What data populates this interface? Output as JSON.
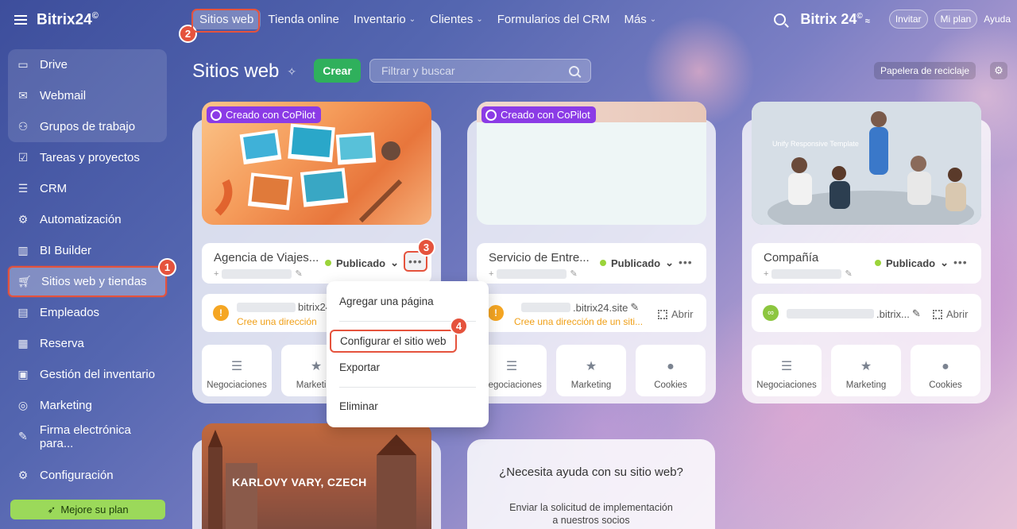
{
  "header": {
    "brand": "Bitrix24",
    "brand_mark": "©",
    "nav": [
      {
        "label": "Sitios web",
        "active": true
      },
      {
        "label": "Tienda online"
      },
      {
        "label": "Inventario",
        "chevron": "⌄"
      },
      {
        "label": "Clientes",
        "chevron": "⌄"
      },
      {
        "label": "Formularios del CRM"
      },
      {
        "label": "Más",
        "chevron": "⌄"
      }
    ],
    "logo_right": "Bitrix 24",
    "invite": "Invitar",
    "my_plan": "Mi plan",
    "help": "Ayuda"
  },
  "sidebar": {
    "items": [
      {
        "label": "Drive",
        "icon": "drive-icon"
      },
      {
        "label": "Webmail",
        "icon": "mail-icon"
      },
      {
        "label": "Grupos de trabajo",
        "icon": "groups-icon"
      },
      {
        "label": "Tareas y proyectos",
        "icon": "tasks-icon"
      },
      {
        "label": "CRM",
        "icon": "crm-icon"
      },
      {
        "label": "Automatización",
        "icon": "automation-icon"
      },
      {
        "label": "BI Builder",
        "icon": "bi-icon"
      },
      {
        "label": "Sitios web y tiendas",
        "icon": "cart-icon",
        "highlight": true
      },
      {
        "label": "Empleados",
        "icon": "employees-icon"
      },
      {
        "label": "Reserva",
        "icon": "calendar-icon"
      },
      {
        "label": "Gestión del inventario",
        "icon": "inventory-icon"
      },
      {
        "label": "Marketing",
        "icon": "marketing-icon"
      },
      {
        "label": "Firma electrónica para...",
        "icon": "signature-icon"
      }
    ],
    "settings": "Configuración",
    "upgrade": "Mejore su plan"
  },
  "page": {
    "title": "Sitios web",
    "create": "Crear",
    "filter_placeholder": "Filtrar y buscar",
    "trash": "Papelera de reciclaje"
  },
  "cards": [
    {
      "copilot": "Creado con CoPilot",
      "name": "Agencia de Viajes...",
      "status": "Publicado",
      "url_suffix": "bitrix24",
      "url_warning": "Cree una dirección",
      "tiles": [
        "Negociaciones",
        "Marketing"
      ]
    },
    {
      "copilot": "Creado con CoPilot",
      "name": "Servicio de Entre...",
      "status": "Publicado",
      "url_suffix": ".bitrix24.site",
      "url_warning": "Cree una dirección de un siti...",
      "open": "Abrir",
      "tiles": [
        "Negociaciones",
        "Marketing",
        "Cookies"
      ]
    },
    {
      "name": "Compañía",
      "status": "Publicado",
      "url_suffix": ".bitrix...",
      "open": "Abrir",
      "tiles": [
        "Negociaciones",
        "Marketing",
        "Cookies"
      ],
      "thumb_text": "Unify Responsive Template"
    }
  ],
  "menu": {
    "add_page": "Agregar una página",
    "configure": "Configurar el sitio web",
    "export": "Exportar",
    "delete": "Eliminar"
  },
  "bottom": {
    "city": "KARLOVY VARY, CZECH",
    "help_title": "¿Necesita ayuda con su sitio web?",
    "help_line1": "Enviar la solicitud de implementación",
    "help_line2": "a nuestros socios"
  },
  "badges": [
    "1",
    "2",
    "3",
    "4"
  ],
  "colors": {
    "accent_green": "#2fb05c",
    "highlight_red": "#e5533d",
    "copilot_purple": "#8b3be6",
    "warning": "#f5a623",
    "published_dot": "#9bd43a"
  }
}
